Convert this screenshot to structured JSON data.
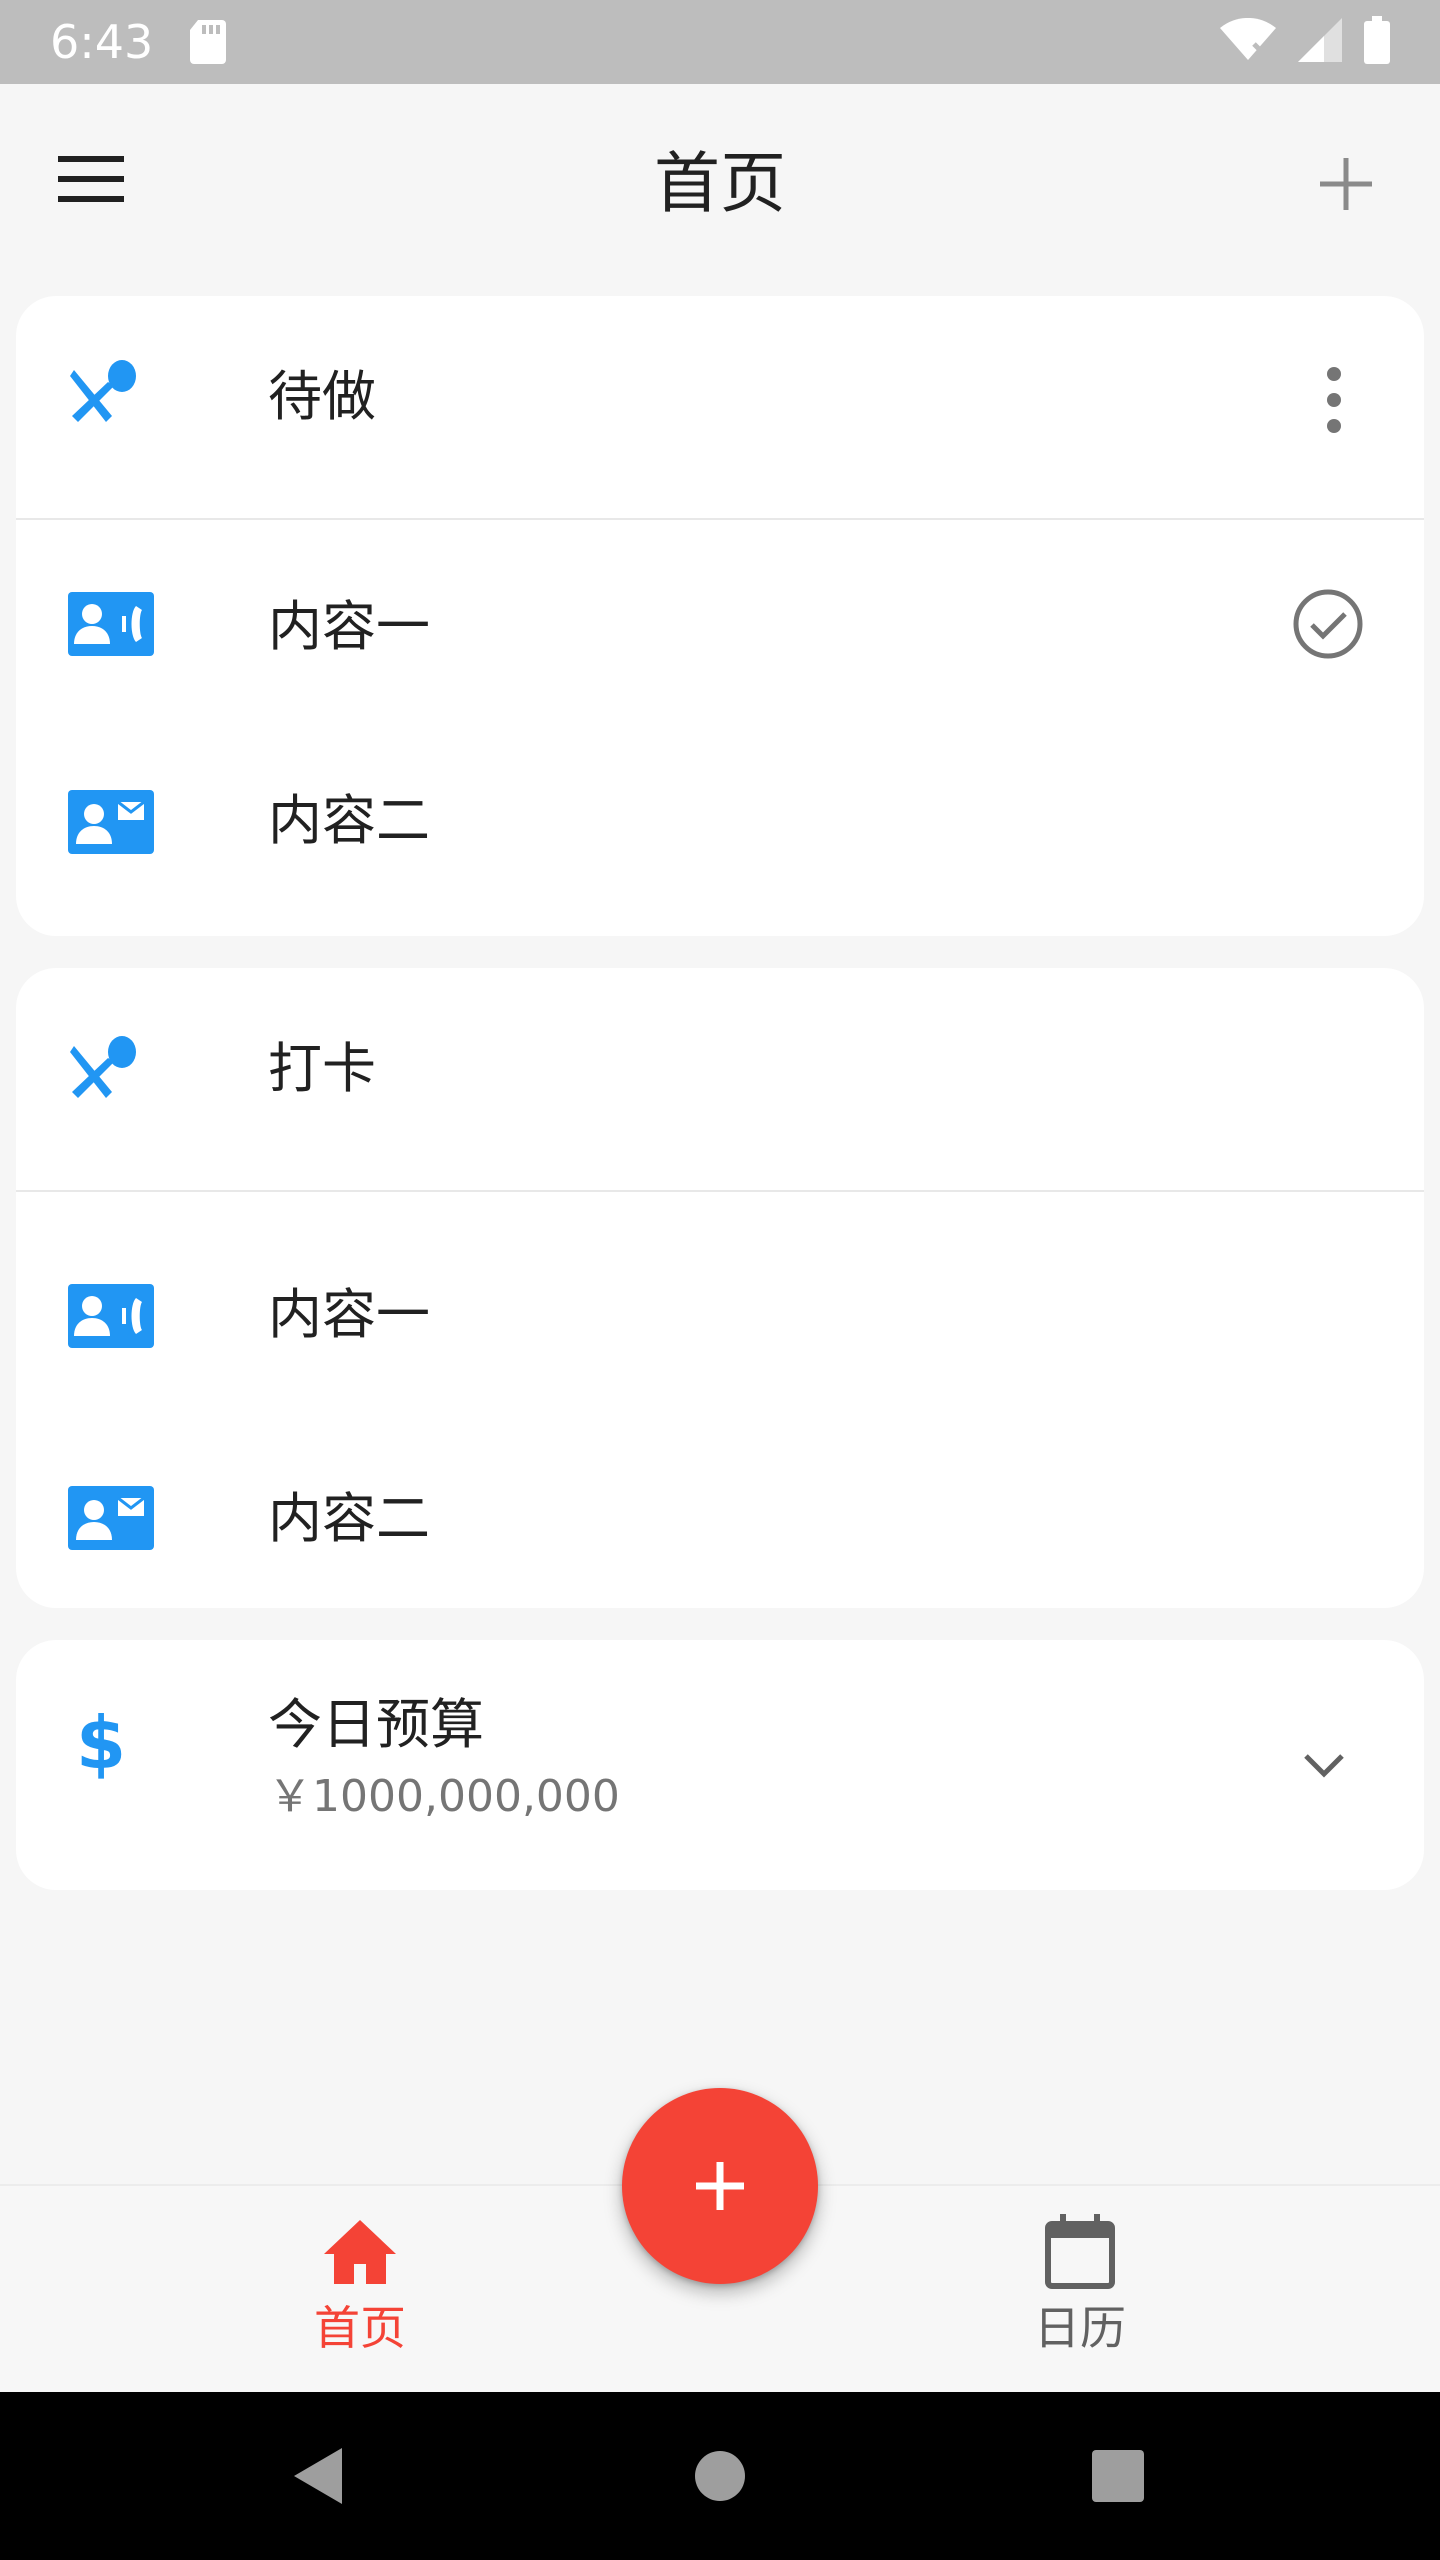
{
  "status_bar": {
    "time": "6:43",
    "icons": [
      "sd-card-icon",
      "wifi-icon",
      "signal-icon",
      "battery-icon"
    ]
  },
  "app_bar": {
    "title": "首页",
    "menu_icon": "menu-icon",
    "add_icon": "add-icon"
  },
  "cards": [
    {
      "header": {
        "label": "待做",
        "icon": "utensils-icon",
        "action_icon": "more-vert-icon"
      },
      "items": [
        {
          "label": "内容一",
          "icon": "contact-phone-icon",
          "checked": true
        },
        {
          "label": "内容二",
          "icon": "contact-mail-icon",
          "checked": false
        }
      ]
    },
    {
      "header": {
        "label": "打卡",
        "icon": "utensils-icon"
      },
      "items": [
        {
          "label": "内容一",
          "icon": "contact-phone-icon"
        },
        {
          "label": "内容二",
          "icon": "contact-mail-icon"
        }
      ]
    }
  ],
  "budget": {
    "title": "今日预算",
    "amount": "￥1000,000,000",
    "icon": "dollar-icon",
    "expand_icon": "chevron-down-icon"
  },
  "bottom_nav": {
    "items": [
      {
        "label": "首页",
        "icon": "home-icon",
        "active": true
      },
      {
        "label": "日历",
        "icon": "calendar-icon",
        "active": false
      }
    ],
    "fab_icon": "add-icon"
  },
  "colors": {
    "accent": "#f44336",
    "icon_blue": "#2196f3",
    "status_bar": "#bdbdbd",
    "background": "#f6f6f6"
  }
}
